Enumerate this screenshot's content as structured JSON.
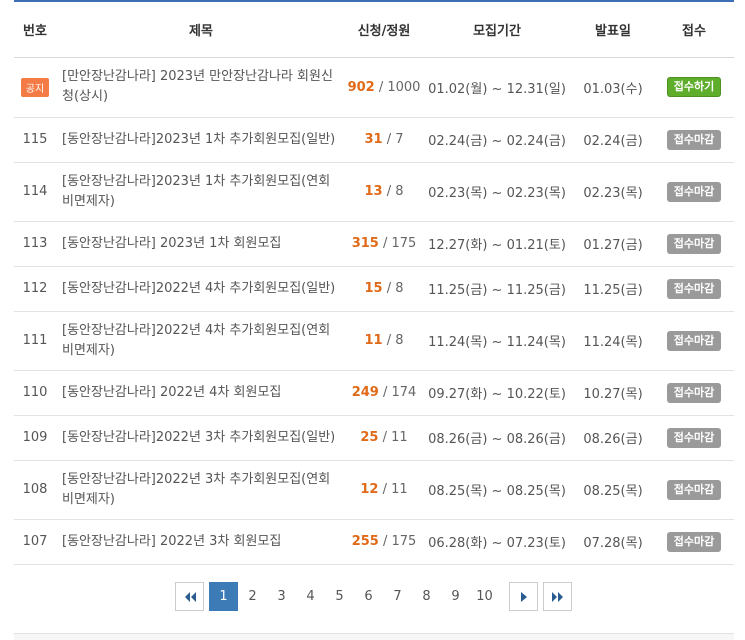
{
  "headers": {
    "no": "번호",
    "title": "제목",
    "count": "신청/정원",
    "period": "모집기간",
    "announce": "발표일",
    "status": "접수"
  },
  "rows": [
    {
      "no": "",
      "notice": "공지",
      "title": "[만안장난감나라] 2023년 만안장난감나라 회원신청(상시)",
      "applied": "902",
      "capacity": " / 1000",
      "period": "01.02(월) ~ 12.31(일)",
      "announce": "01.03(수)",
      "status": "접수하기",
      "open": true
    },
    {
      "no": "115",
      "title": "[동안장난감나라]2023년 1차 추가회원모집(일반)",
      "applied": "31",
      "capacity": " / 7",
      "period": "02.24(금) ~ 02.24(금)",
      "announce": "02.24(금)",
      "status": "접수마감"
    },
    {
      "no": "114",
      "title": "[동안장난감나라]2023년 1차 추가회원모집(연회비면제자)",
      "applied": "13",
      "capacity": " / 8",
      "period": "02.23(목) ~ 02.23(목)",
      "announce": "02.23(목)",
      "status": "접수마감"
    },
    {
      "no": "113",
      "title": "[동안장난감나라] 2023년 1차 회원모집",
      "applied": "315",
      "capacity": " / 175",
      "period": "12.27(화) ~ 01.21(토)",
      "announce": "01.27(금)",
      "status": "접수마감"
    },
    {
      "no": "112",
      "title": "[동안장난감나라]2022년 4차 추가회원모집(일반)",
      "applied": "15",
      "capacity": " / 8",
      "period": "11.25(금) ~ 11.25(금)",
      "announce": "11.25(금)",
      "status": "접수마감"
    },
    {
      "no": "111",
      "title": "[동안장난감나라]2022년 4차 추가회원모집(연회비면제자)",
      "applied": "11",
      "capacity": " / 8",
      "period": "11.24(목) ~ 11.24(목)",
      "announce": "11.24(목)",
      "status": "접수마감"
    },
    {
      "no": "110",
      "title": "[동안장난감나라] 2022년 4차 회원모집",
      "applied": "249",
      "capacity": " / 174",
      "period": "09.27(화) ~ 10.22(토)",
      "announce": "10.27(목)",
      "status": "접수마감"
    },
    {
      "no": "109",
      "title": "[동안장난감나라]2022년 3차 추가회원모집(일반)",
      "applied": "25",
      "capacity": " / 11",
      "period": "08.26(금) ~ 08.26(금)",
      "announce": "08.26(금)",
      "status": "접수마감"
    },
    {
      "no": "108",
      "title": "[동안장난감나라]2022년 3차 추가회원모집(연회비면제자)",
      "applied": "12",
      "capacity": " / 11",
      "period": "08.25(목) ~ 08.25(목)",
      "announce": "08.25(목)",
      "status": "접수마감"
    },
    {
      "no": "107",
      "title": "[동안장난감나라] 2022년 3차 회원모집",
      "applied": "255",
      "capacity": " / 175",
      "period": "06.28(화) ~ 07.23(토)",
      "announce": "07.28(목)",
      "status": "접수마감"
    }
  ],
  "pagination": {
    "pages": [
      "1",
      "2",
      "3",
      "4",
      "5",
      "6",
      "7",
      "8",
      "9",
      "10"
    ],
    "current": "1",
    "icons": {
      "first": "double-chevron-left-icon",
      "next": "chevron-right-icon",
      "last": "double-chevron-right-icon"
    }
  },
  "colors": {
    "accent": "#3d6fb6",
    "open_button": "#5fae2b",
    "closed_button": "#9a9a9a",
    "notice_badge": "#f47b46",
    "applied_count": "#e06a18"
  }
}
